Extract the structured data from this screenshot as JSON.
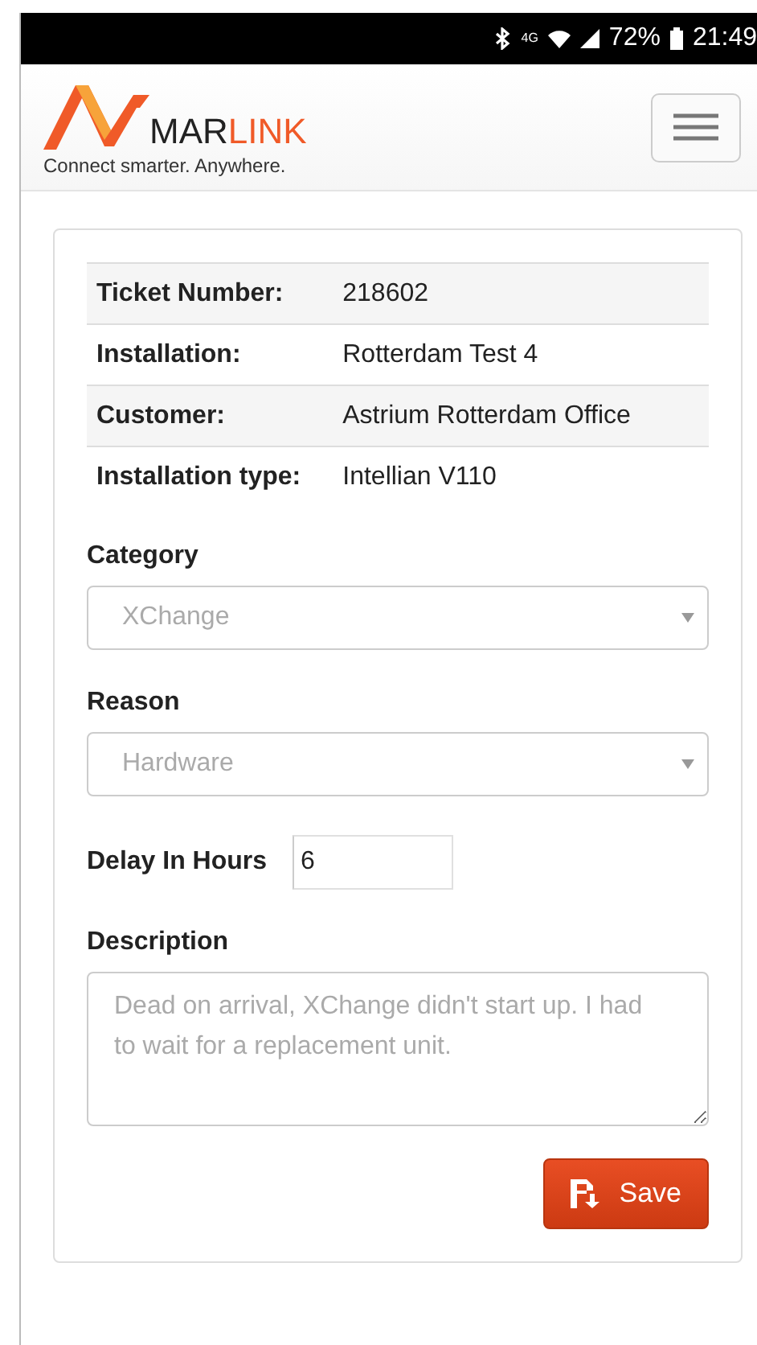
{
  "status_bar": {
    "network": "4G",
    "battery": "72%",
    "time": "21:49"
  },
  "header": {
    "logo": {
      "wordmark_parts": [
        "MAR",
        "LINK"
      ],
      "tagline": "Connect smarter. Anywhere."
    }
  },
  "details": [
    {
      "label": "Ticket Number:",
      "value": "218602"
    },
    {
      "label": "Installation:",
      "value": "Rotterdam Test 4"
    },
    {
      "label": "Customer:",
      "value": "Astrium Rotterdam Office"
    },
    {
      "label": "Installation type:",
      "value": "Intellian V110"
    }
  ],
  "form": {
    "category": {
      "label": "Category",
      "value": "XChange",
      "disabled": true
    },
    "reason": {
      "label": "Reason",
      "value": "Hardware",
      "disabled": true
    },
    "delay": {
      "label": "Delay In Hours",
      "value": "6"
    },
    "description": {
      "label": "Description",
      "placeholder": "Dead on arrival, XChange didn't start up. I had to wait for a replacement unit."
    },
    "save_button": "Save"
  }
}
